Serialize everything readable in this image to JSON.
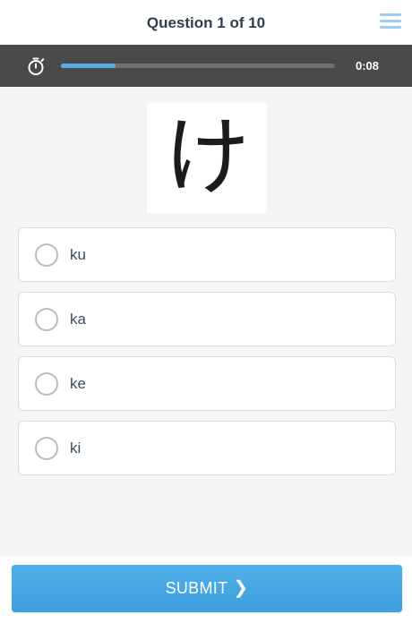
{
  "header": {
    "title": "Question 1 of 10",
    "menu_icon": "hamburger-menu-icon",
    "menu_color": "#9dcdf0"
  },
  "timer": {
    "icon": "stopwatch-icon",
    "elapsed": "0:08",
    "progress_fraction": 0.2,
    "progress_color": "#5aaee8",
    "bar_color": "#4a4a4a"
  },
  "question": {
    "character": "け"
  },
  "options": [
    {
      "label": "ku",
      "selected": false
    },
    {
      "label": "ka",
      "selected": false
    },
    {
      "label": "ke",
      "selected": false
    },
    {
      "label": "ki",
      "selected": false
    }
  ],
  "submit": {
    "label": "SUBMIT",
    "icon": "chevron-right-icon",
    "color": "#4aa8e4"
  }
}
